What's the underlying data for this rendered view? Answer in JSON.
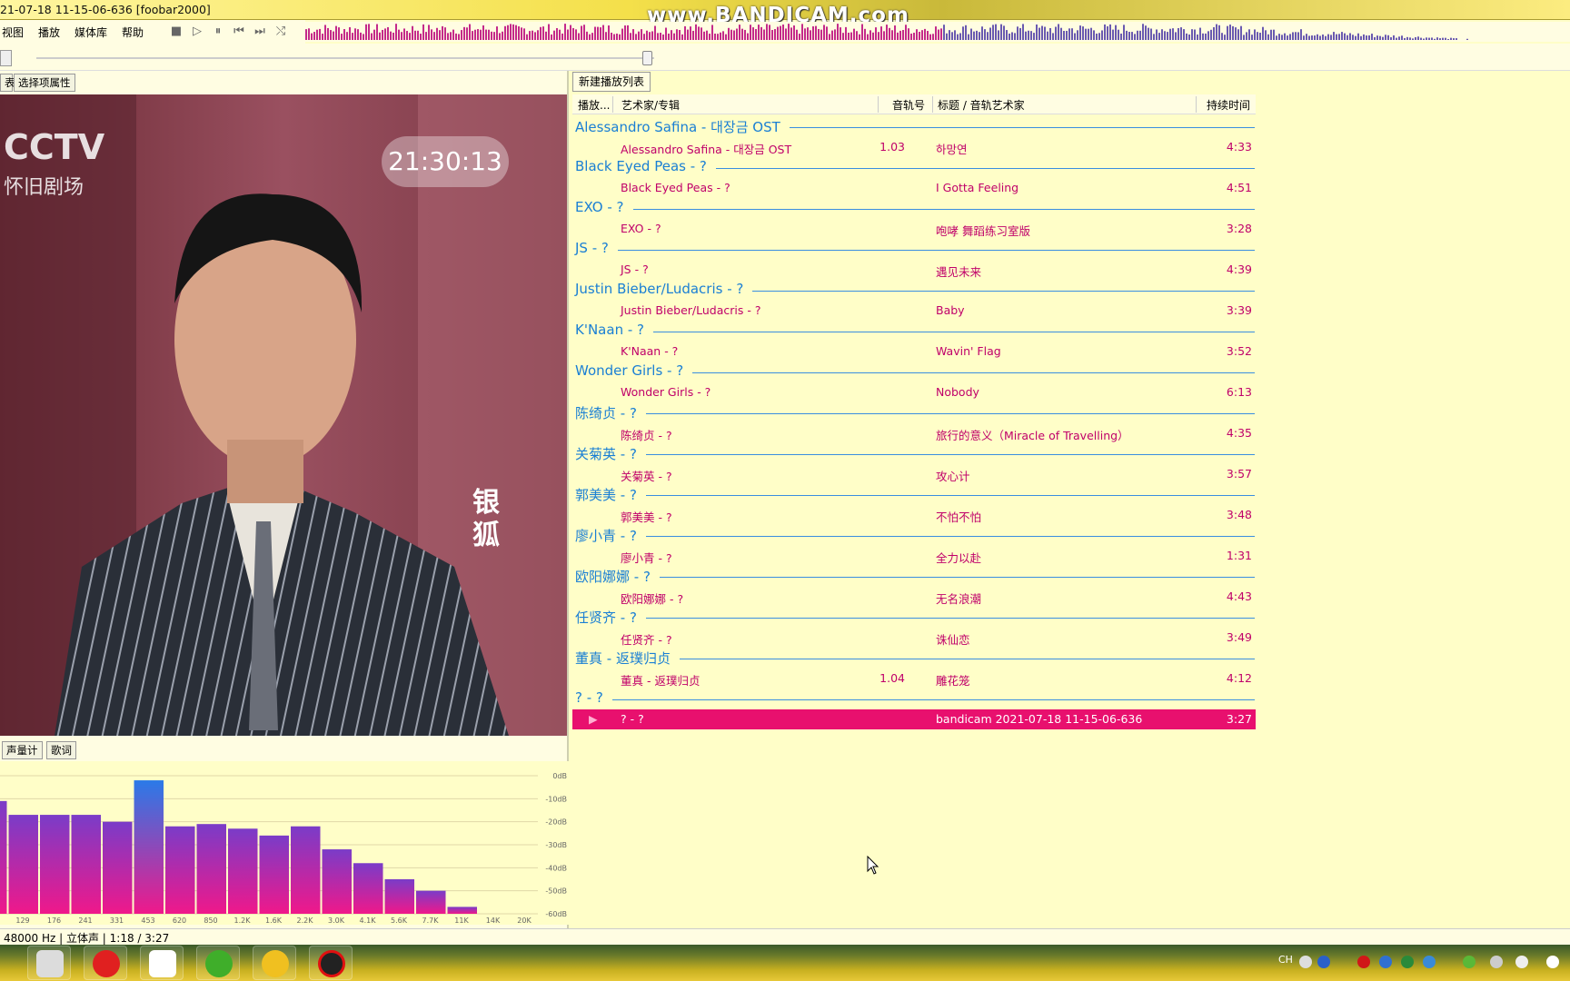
{
  "window": {
    "title": "21-07-18 11-15-06-636  [foobar2000]"
  },
  "watermark": "www.BANDICAM.com",
  "menu": [
    {
      "label": "视图"
    },
    {
      "label": "播放"
    },
    {
      "label": "媒体库"
    },
    {
      "label": "帮助"
    }
  ],
  "toolbar": {
    "stop": "■",
    "play": "▷",
    "pause": "⏸",
    "prev": "⏮",
    "next": "⏭",
    "random": "⤭"
  },
  "left_tabs": {
    "tab_a": "表",
    "tab_b": "选择项属性"
  },
  "video": {
    "channel_logo": "CCTV",
    "channel_sub": "怀旧剧场",
    "clock": "21:30:13",
    "caption_line1": "银",
    "caption_line2": "狐"
  },
  "lower_tabs": {
    "tab_a": "声量计",
    "tab_b": "歌词"
  },
  "spectrum": {
    "db_labels": [
      "0dB",
      "-10dB",
      "-20dB",
      "-30dB",
      "-40dB",
      "-50dB",
      "-60dB"
    ],
    "freq_labels": [
      "129",
      "176",
      "241",
      "331",
      "453",
      "620",
      "850",
      "1.2K",
      "1.6K",
      "2.2K",
      "3.0K",
      "4.1K",
      "5.6K",
      "7.7K",
      "11K",
      "14K",
      "20K"
    ],
    "levels_db": [
      -11,
      -17,
      -17,
      -17,
      -20,
      -2,
      -22,
      -21,
      -23,
      -26,
      -22,
      -32,
      -38,
      -45,
      -50,
      -57,
      -60,
      -60
    ]
  },
  "playlist": {
    "tab_label": "新建播放列表",
    "columns": {
      "playing": "播放...",
      "artist_album": "艺术家/专辑",
      "track_no": "音轨号",
      "title": "标题 / 音轨艺术家",
      "duration": "持续时间"
    },
    "groups": [
      {
        "header": "Alessandro Safina - 대장금 OST",
        "artist": "Alessandro Safina - 대장금 OST",
        "track": "1.03",
        "title": "하망연",
        "duration": "4:33"
      },
      {
        "header": "Black Eyed Peas - ?",
        "artist": "Black Eyed Peas - ?",
        "track": "",
        "title": "I Gotta Feeling",
        "duration": "4:51"
      },
      {
        "header": "EXO - ?",
        "artist": "EXO - ?",
        "track": "",
        "title": "咆哮 舞蹈练习室版",
        "duration": "3:28"
      },
      {
        "header": "JS - ?",
        "artist": "JS - ?",
        "track": "",
        "title": "遇见未来",
        "duration": "4:39"
      },
      {
        "header": "Justin Bieber/Ludacris - ?",
        "artist": "Justin Bieber/Ludacris - ?",
        "track": "",
        "title": "Baby",
        "duration": "3:39"
      },
      {
        "header": "K'Naan - ?",
        "artist": "K'Naan - ?",
        "track": "",
        "title": "Wavin' Flag",
        "duration": "3:52"
      },
      {
        "header": "Wonder Girls - ?",
        "artist": "Wonder Girls - ?",
        "track": "",
        "title": "Nobody",
        "duration": "6:13"
      },
      {
        "header": "陈绮贞 - ?",
        "artist": "陈绮贞 - ?",
        "track": "",
        "title": "旅行的意义（Miracle of Travelling）",
        "duration": "4:35"
      },
      {
        "header": "关菊英 - ?",
        "artist": "关菊英 - ?",
        "track": "",
        "title": "攻心计",
        "duration": "3:57"
      },
      {
        "header": "郭美美 - ?",
        "artist": "郭美美 - ?",
        "track": "",
        "title": "不怕不怕",
        "duration": "3:48"
      },
      {
        "header": "廖小青 - ?",
        "artist": "廖小青 - ?",
        "track": "",
        "title": "全力以赴",
        "duration": "1:31"
      },
      {
        "header": "欧阳娜娜 - ?",
        "artist": "欧阳娜娜 - ?",
        "track": "",
        "title": "无名浪潮",
        "duration": "4:43"
      },
      {
        "header": "任贤齐 - ?",
        "artist": "任贤齐 - ?",
        "track": "",
        "title": "诛仙恋",
        "duration": "3:49"
      },
      {
        "header": "董真 - 返璞归贞",
        "artist": "董真 - 返璞归贞",
        "track": "1.04",
        "title": "雕花笼",
        "duration": "4:12"
      },
      {
        "header": "? - ?",
        "artist": "? - ?",
        "track": "",
        "title": "bandicam 2021-07-18 11-15-06-636",
        "duration": "3:27",
        "playing": true
      }
    ]
  },
  "status": {
    "text": "48000 Hz | 立体声 | 1:18 / 3:27"
  },
  "tray": {
    "lang": "CH"
  },
  "colors": {
    "group": "#1a7fd4",
    "track": "#c0006a",
    "playing_bg": "#e8106e",
    "panel_bg": "#fffec8"
  }
}
